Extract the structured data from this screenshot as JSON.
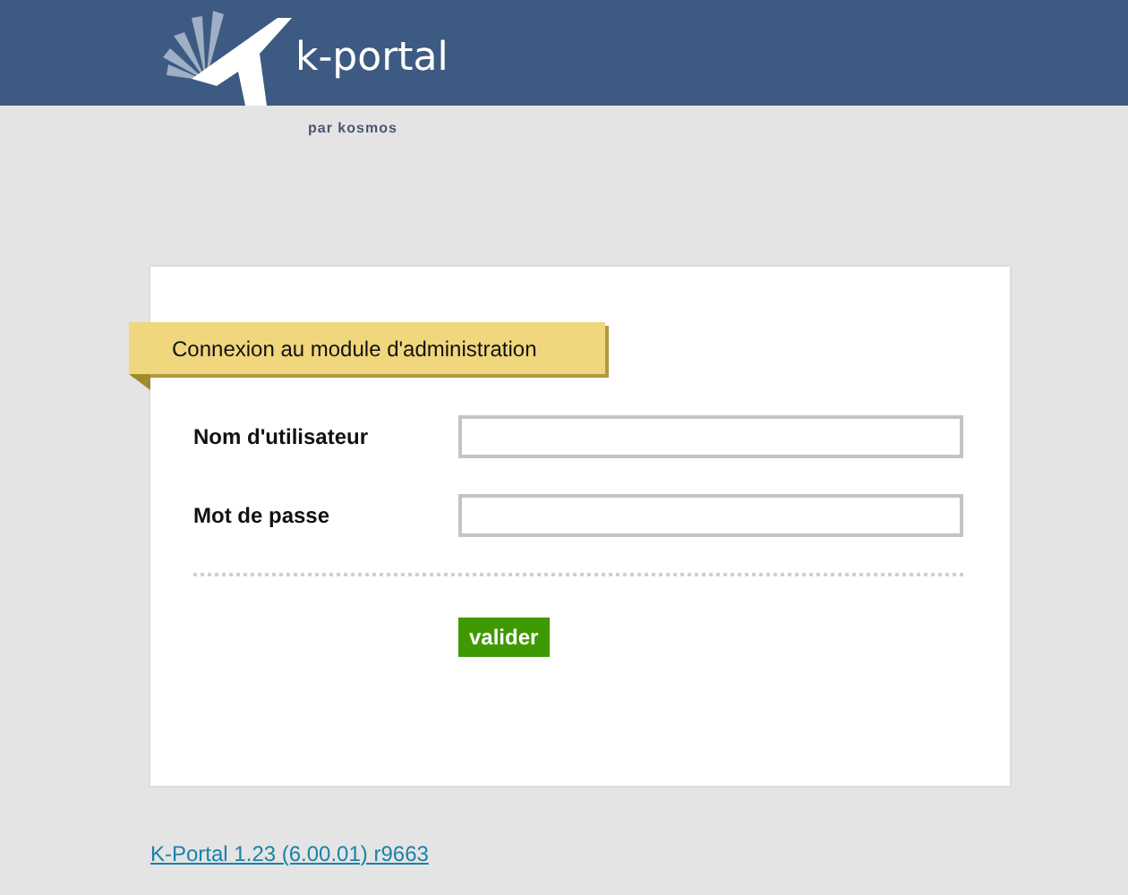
{
  "header": {
    "logo_text": "k-portal",
    "tagline": "par kosmos"
  },
  "login": {
    "title": "Connexion au module d'administration",
    "fields": [
      {
        "label": "Nom d'utilisateur"
      },
      {
        "label": "Mot de passe"
      }
    ],
    "submit": "valider"
  },
  "footer": {
    "version_link": "K-Portal 1.23 (6.00.01) r9663"
  }
}
